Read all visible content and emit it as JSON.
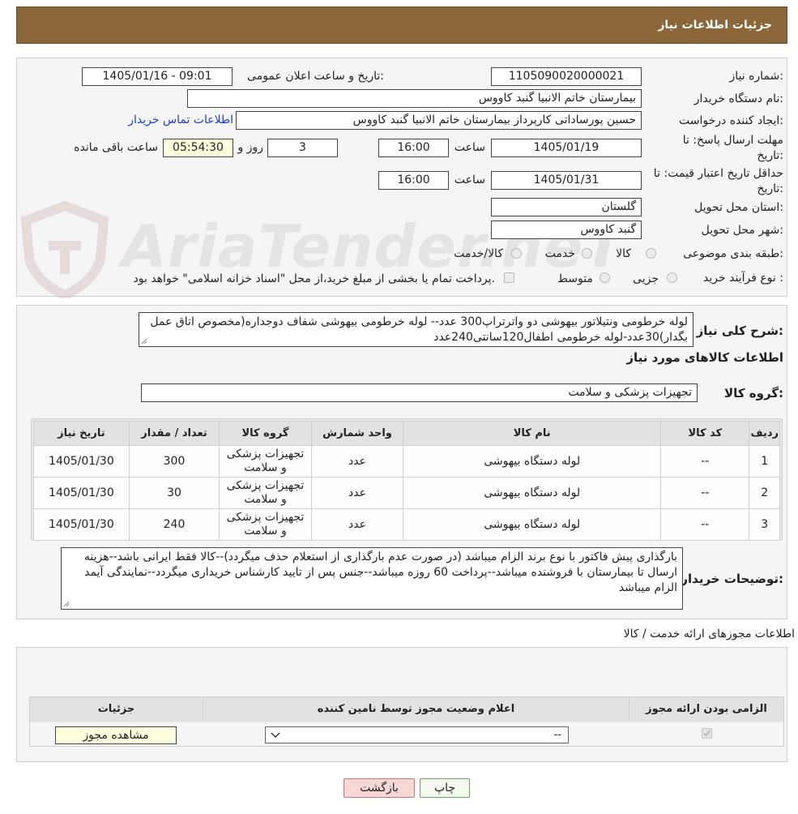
{
  "header": {
    "title": "جزئیات اطلاعات نیاز"
  },
  "form": {
    "need_number_label": "شماره نیاز:",
    "need_number": "1105090020000021",
    "announce_label": "تاریخ و ساعت اعلان عمومی:",
    "announce_value": "1405/01/16 - 09:01",
    "buyer_org_label": "نام دستگاه خریدار:",
    "buyer_org": "بیمارستان خاتم الانبیا گنبد کاووس",
    "creator_label": "ایجاد کننده درخواست:",
    "creator": "حسین پورساداتی کارپرداز بیمارستان خاتم الانبیا گنبد کاووس",
    "contact_link": "اطلاعات تماس خریدار",
    "reply_deadline_label": "مهلت ارسال پاسخ: تا تاریخ:",
    "reply_date": "1405/01/19",
    "time_label": "ساعت",
    "reply_time": "16:00",
    "days_value": "3",
    "days_label": "روز و",
    "remaining_time": "05:54:30",
    "remaining_label": "ساعت باقی مانده",
    "validity_label": "حداقل تاریخ اعتبار قیمت: تا تاریخ:",
    "validity_date": "1405/01/31",
    "validity_time": "16:00",
    "province_label": "استان محل تحویل:",
    "province": "گلستان",
    "city_label": "شهر محل تحویل:",
    "city": "گنبد کاووس",
    "category_label": "طبقه بندی موضوعی:",
    "category_options": [
      "کالا",
      "خدمت",
      "کالا/خدمت"
    ],
    "process_label": "نوع فرآیند خرید :",
    "process_options": [
      "جزیی",
      "متوسط"
    ],
    "payment_note": "پرداخت تمام یا بخشی از مبلغ خرید،از محل \"اسناد خزانه اسلامی\" خواهد بود."
  },
  "description": {
    "label": "شرح کلی نیاز:",
    "text": "لوله خرطومی ونتیلاتور بیهوشی دو واترتراپ300 عدد-- لوله خرطومی بیهوشی شفاف دوجداره(مخصوص اتاق عمل بگدار)30عدد-لوله خرطومی اطفال120سانتی240عدد"
  },
  "goods": {
    "section_title": "اطلاعات کالاهای مورد نیاز",
    "group_label": "گروه کالا:",
    "group_value": "تجهیزات پزشکی و سلامت",
    "columns": [
      "ردیف",
      "کد کالا",
      "نام کالا",
      "واحد شمارش",
      "گروه کالا",
      "تعداد / مقدار",
      "تاریخ نیاز"
    ],
    "rows": [
      {
        "row": "1",
        "code": "--",
        "name": "لوله دستگاه بیهوشی",
        "unit": "عدد",
        "group": "تجهیزات پزشکی و سلامت",
        "qty": "300",
        "date": "1405/01/30"
      },
      {
        "row": "2",
        "code": "--",
        "name": "لوله دستگاه بیهوشی",
        "unit": "عدد",
        "group": "تجهیزات پزشکی و سلامت",
        "qty": "30",
        "date": "1405/01/30"
      },
      {
        "row": "3",
        "code": "--",
        "name": "لوله دستگاه بیهوشی",
        "unit": "عدد",
        "group": "تجهیزات پزشکی و سلامت",
        "qty": "240",
        "date": "1405/01/30"
      }
    ],
    "buyer_notes_label": "توضیحات خریدار:",
    "buyer_notes": "بارگذاری پیش فاکتور با نوع برند الزام میباشد (در صورت عدم بارگذاری از استعلام حذف میگردد)--کالا فقط ایرانی باشد--هزینه ارسال تا بیمارستان با فروشنده میباشد--پرداخت 60 روزه میباشد--جنس پس از تایید کارشناس خریداری میگردد--نمایندگی آیمد الزام میباشد"
  },
  "permits": {
    "section_title": "اطلاعات مجوزهای ارائه خدمت / کالا",
    "columns": [
      "الزامی بودن ارائه مجوز",
      "اعلام وضعیت مجوز توسط نامین کننده",
      "جزئیات"
    ],
    "select_value": "--",
    "view_button": "مشاهده مجوز"
  },
  "actions": {
    "print": "چاپ",
    "back": "بازگشت"
  },
  "watermark": "AriaTender.neT",
  "colors": {
    "header_bg": "#8b6638",
    "link": "#1a3fcc",
    "back_button_bg": "#f8d7d7"
  }
}
